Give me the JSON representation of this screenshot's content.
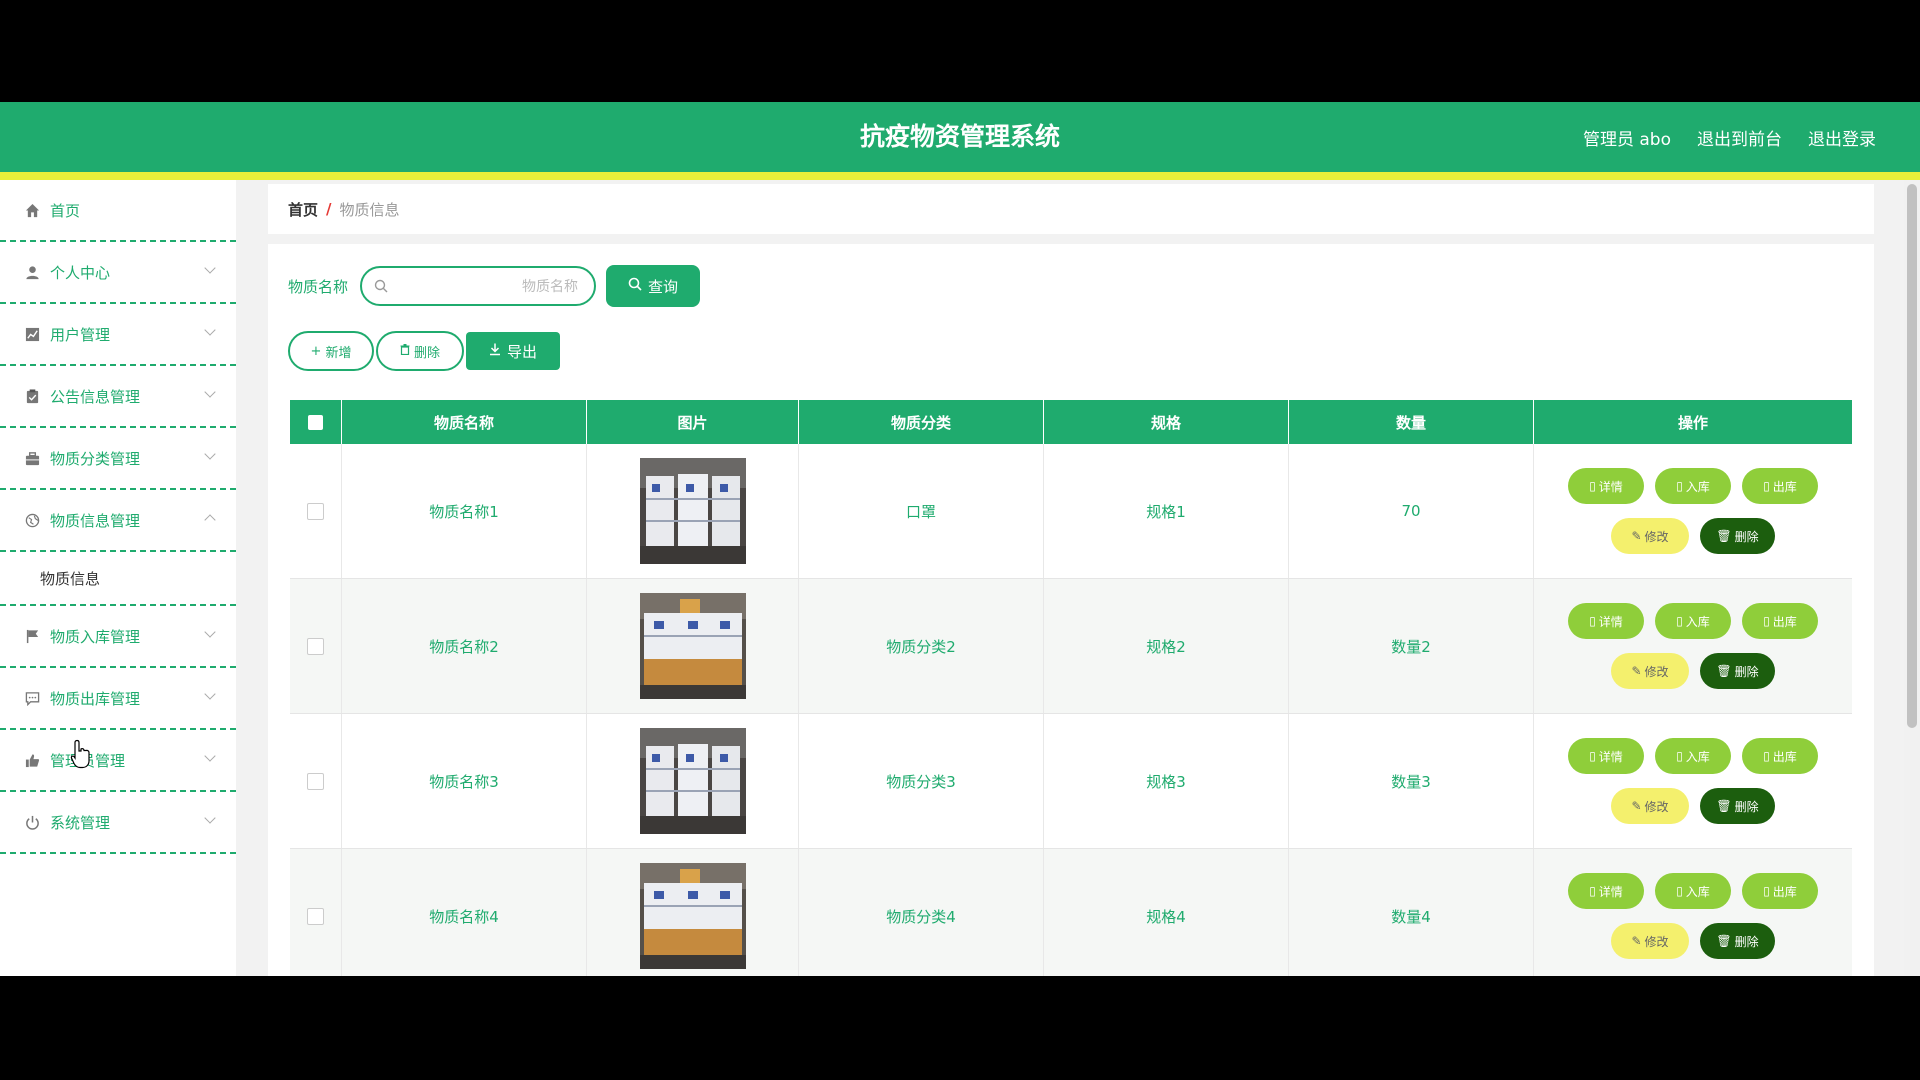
{
  "header": {
    "title": "抗疫物资管理系统",
    "user_label": "管理员 abo",
    "front_link": "退出到前台",
    "logout": "退出登录"
  },
  "sidebar": {
    "items": [
      {
        "label": "首页",
        "icon": "home-icon"
      },
      {
        "label": "个人中心",
        "icon": "user-icon"
      },
      {
        "label": "用户管理",
        "icon": "chart-icon"
      },
      {
        "label": "公告信息管理",
        "icon": "clipboard-icon"
      },
      {
        "label": "物质分类管理",
        "icon": "briefcase-icon"
      },
      {
        "label": "物质信息管理",
        "icon": "globe-icon",
        "sub": "物质信息"
      },
      {
        "label": "物质入库管理",
        "icon": "flag-icon"
      },
      {
        "label": "物质出库管理",
        "icon": "message-icon"
      },
      {
        "label": "管理员管理",
        "icon": "thumbs-up-icon"
      },
      {
        "label": "系统管理",
        "icon": "power-icon"
      }
    ]
  },
  "breadcrumb": {
    "home": "首页",
    "sep": "/",
    "current": "物质信息"
  },
  "search": {
    "label": "物质名称",
    "placeholder": "物质名称",
    "query_button": "查询"
  },
  "actions": {
    "add": "新增",
    "delete": "删除",
    "export": "导出"
  },
  "table": {
    "headers": [
      "物质名称",
      "图片",
      "物质分类",
      "规格",
      "数量",
      "操作"
    ],
    "rows": [
      {
        "name": "物质名称1",
        "category": "口罩",
        "spec": "规格1",
        "qty": "70"
      },
      {
        "name": "物质名称2",
        "category": "物质分类2",
        "spec": "规格2",
        "qty": "数量2"
      },
      {
        "name": "物质名称3",
        "category": "物质分类3",
        "spec": "规格3",
        "qty": "数量3"
      },
      {
        "name": "物质名称4",
        "category": "物质分类4",
        "spec": "规格4",
        "qty": "数量4"
      }
    ],
    "op_labels": {
      "detail": "详情",
      "in": "入库",
      "out": "出库",
      "edit": "修改",
      "del": "删除"
    }
  },
  "colors": {
    "primary": "#1fab6e",
    "accent_line": "#e8f03a",
    "op_green": "#8fce3a",
    "op_yellow": "#f4f06d",
    "op_dark": "#1c5e0e"
  }
}
